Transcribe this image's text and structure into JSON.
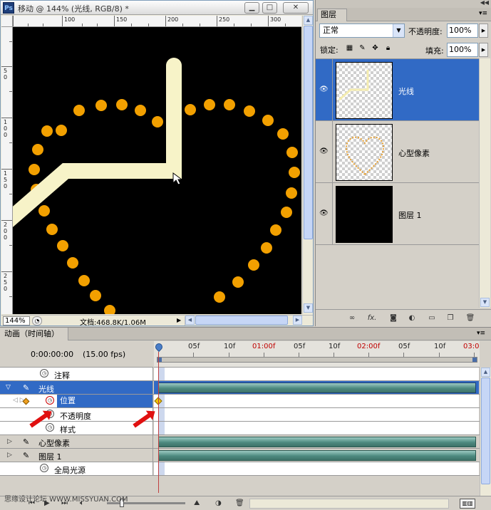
{
  "document": {
    "title": "移动 @ 144% (光线, RGB/8) *",
    "ruler_top": [
      "100",
      "150",
      "200",
      "250",
      "300"
    ],
    "ruler_left": [
      "5\n0",
      "1\n0\n0",
      "1\n5\n0",
      "2\n0\n0",
      "2\n5\n0"
    ],
    "zoom": "144%",
    "info": "文档:468.8K/1.06M"
  },
  "layers_panel": {
    "tab": "图层",
    "blend_mode": "正常",
    "opacity_label": "不透明度:",
    "opacity_value": "100%",
    "lock_label": "锁定:",
    "fill_label": "填充:",
    "fill_value": "100%",
    "layers": [
      {
        "name": "光线",
        "selected": true
      },
      {
        "name": "心型像素",
        "selected": false
      },
      {
        "name": "图层 1",
        "selected": false
      }
    ]
  },
  "animation": {
    "tab": "动画（时间轴）",
    "current_time": "0:00:00:00",
    "fps": "(15.00 fps)",
    "timeline_labels": [
      {
        "text": "05f",
        "red": false
      },
      {
        "text": "10f",
        "red": false
      },
      {
        "text": "01:00f",
        "red": true
      },
      {
        "text": "05f",
        "red": false
      },
      {
        "text": "10f",
        "red": false
      },
      {
        "text": "02:00f",
        "red": true
      },
      {
        "text": "05f",
        "red": false
      },
      {
        "text": "10f",
        "red": false
      },
      {
        "text": "03:0",
        "red": true
      }
    ],
    "tracks": {
      "comments": "注释",
      "layer1": "光线",
      "position": "位置",
      "opacity": "不透明度",
      "style": "样式",
      "layer2": "心型像素",
      "layer3": "图层 1",
      "global_light": "全局光源"
    },
    "watermark": "思缘设计论坛 WWW.MISSYUAN.COM"
  },
  "colors": {
    "selection": "#316ac5",
    "layer_bar": "#4d8a80",
    "heart_dot": "#f2a000",
    "light_beam": "#f7f3c8",
    "keyframe": "#f2c400",
    "annotation_arrow": "#e01010"
  }
}
